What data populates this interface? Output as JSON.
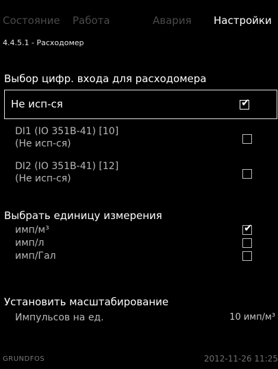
{
  "tabs": [
    {
      "label": "Состояние",
      "active": false
    },
    {
      "label": "Работа",
      "active": false
    },
    {
      "label": "Авария",
      "active": false
    },
    {
      "label": "Настройки",
      "active": true
    }
  ],
  "menu_code": "4.4.5.1 - Расходомер",
  "input_section": {
    "heading": "Выбор цифр. входа для расходомера",
    "options": [
      {
        "label": "Не исп-ся",
        "checked": true
      },
      {
        "label_line1": "DI1 (IO 351B-41) [10]",
        "label_line2": "(Не исп-ся)",
        "checked": false
      },
      {
        "label_line1": "DI2 (IO 351B-41) [12]",
        "label_line2": "(Не исп-ся)",
        "checked": false
      }
    ]
  },
  "unit_section": {
    "heading": "Выбрать единицу измерения",
    "options": [
      {
        "label": "имп/м³",
        "checked": true
      },
      {
        "label": "имп/л",
        "checked": false
      },
      {
        "label": "имп/Гал",
        "checked": false
      }
    ]
  },
  "scale_section": {
    "heading": "Установить масштабирование",
    "row_label": "Импульсов на ед.",
    "row_value": "10 имп/м³"
  },
  "footer": {
    "brand": "GRUNDFOS",
    "datetime": "2012-11-26 11:25"
  },
  "colors": {
    "background": "#000000",
    "text": "#ffffff",
    "inactive_tab": "#4a4a4a"
  }
}
